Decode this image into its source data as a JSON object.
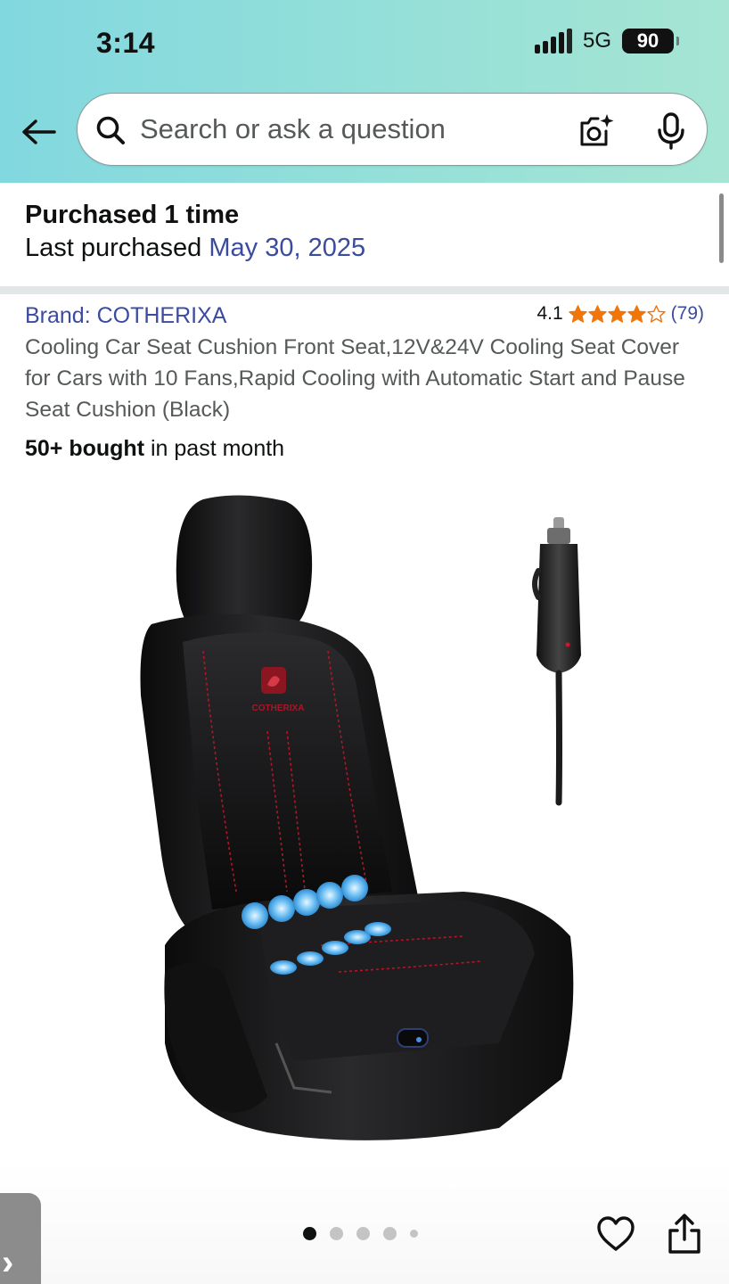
{
  "status_bar": {
    "time": "3:14",
    "network": "5G",
    "battery": "90"
  },
  "search": {
    "placeholder": "Search or ask a question"
  },
  "purchase": {
    "count_text": "Purchased 1 time",
    "last_label": "Last purchased ",
    "last_date": "May 30, 2025"
  },
  "product": {
    "brand": "Brand: COTHERIXA",
    "rating_value": "4.1",
    "rating_stars": 4.1,
    "rating_count": "(79)",
    "title": "Cooling Car Seat Cushion Front Seat,12V&24V Cooling Seat Cover for Cars with 10 Fans,Rapid Cooling with Automatic Start and Pause Seat Cushion (Black)",
    "bought_bold": "50+ bought",
    "bought_rest": " in past month",
    "seat_logo_text": "COTHERIXA"
  },
  "gallery": {
    "dot_count": 5,
    "active_index": 0
  },
  "colors": {
    "header_gradient_start": "#82d8df",
    "header_gradient_end": "#a6e5d3",
    "link": "#3b4ba0",
    "star": "#f0760a",
    "seat_stitch": "#b0172a",
    "fan_blue": "#59b9f2"
  },
  "icons": {
    "back": "arrow-left-icon",
    "search": "search-icon",
    "camera": "camera-sparkle-icon",
    "mic": "microphone-icon",
    "wishlist": "heart-icon",
    "share": "share-icon",
    "side_tab": "chevron-right-icon"
  }
}
